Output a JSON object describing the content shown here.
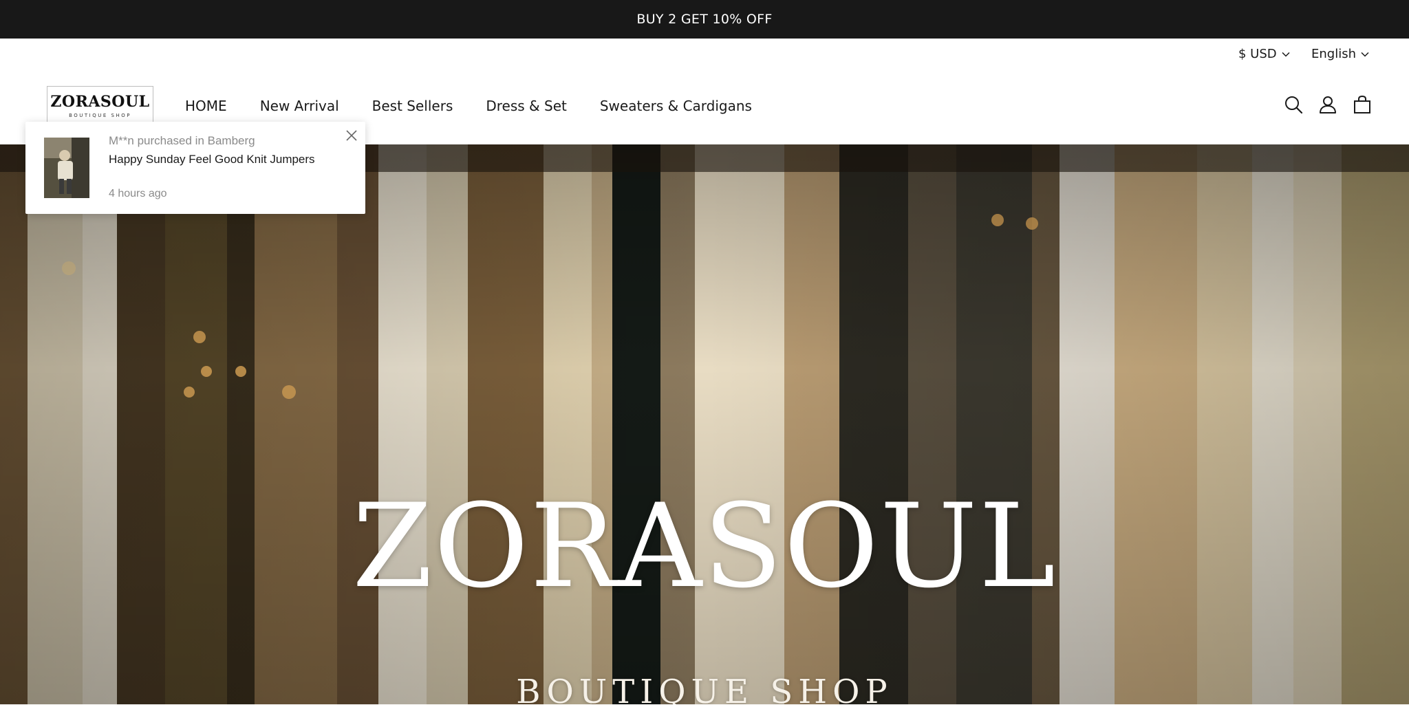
{
  "announcement": {
    "text": "BUY 2 GET 10% OFF"
  },
  "locale": {
    "currency": "$ USD",
    "language": "English"
  },
  "brand": {
    "logo_name": "ZORASOUL",
    "logo_tagline": "BOUTIQUE SHOP"
  },
  "nav": {
    "items": [
      {
        "label": "HOME"
      },
      {
        "label": "New Arrival"
      },
      {
        "label": "Best Sellers"
      },
      {
        "label": "Dress & Set"
      },
      {
        "label": "Sweaters & Cardigans"
      }
    ]
  },
  "header_icons": [
    "search-icon",
    "account-icon",
    "cart-icon"
  ],
  "hero": {
    "title": "ZORASOUL",
    "subtitle": "BOUTIQUE SHOP"
  },
  "purchase_popup": {
    "line1": "M**n purchased in Bamberg",
    "product": "Happy Sunday Feel Good Knit Jumpers",
    "time": "4 hours ago"
  },
  "colors": {
    "announcement_bg": "#181818",
    "text": "#1a1a1a",
    "muted": "#8a8a8a"
  }
}
